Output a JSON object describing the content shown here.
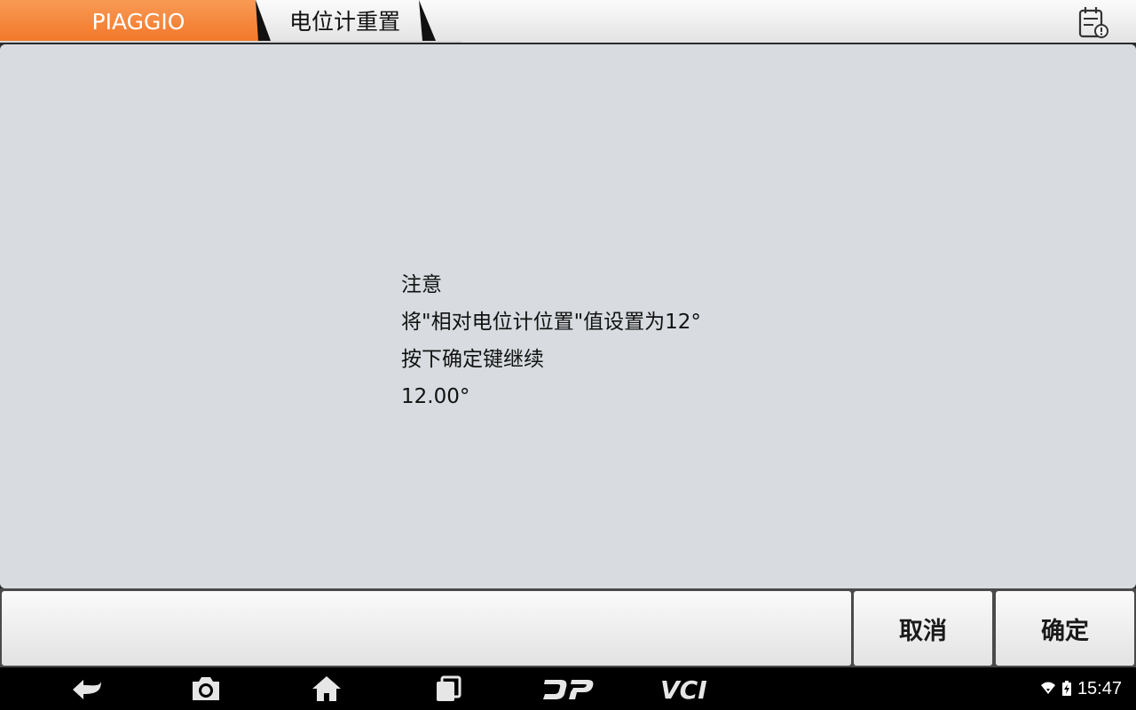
{
  "breadcrumb": {
    "brand": "PIAGGIO",
    "page": "电位计重置"
  },
  "colors": {
    "accent_orange": "#f7853a",
    "panel_bg": "#d8dce0",
    "navbar_bg": "#000000"
  },
  "toolbar": {
    "report_icon": "diagnostic-report-icon"
  },
  "message": {
    "lines": [
      "注意",
      "将\"相对电位计位置\"值设置为12°",
      "按下确定键继续",
      "12.00°"
    ]
  },
  "actions": {
    "cancel_label": "取消",
    "ok_label": "确定"
  },
  "navbar": {
    "icons": [
      "back-icon",
      "screenshot-icon",
      "home-icon",
      "recent-apps-icon",
      "dp-icon",
      "vci-icon"
    ],
    "dp_label": "DP",
    "vci_label": "VCI"
  },
  "status": {
    "time": "15:47",
    "icons": [
      "wifi-icon",
      "battery-charging-icon"
    ]
  }
}
